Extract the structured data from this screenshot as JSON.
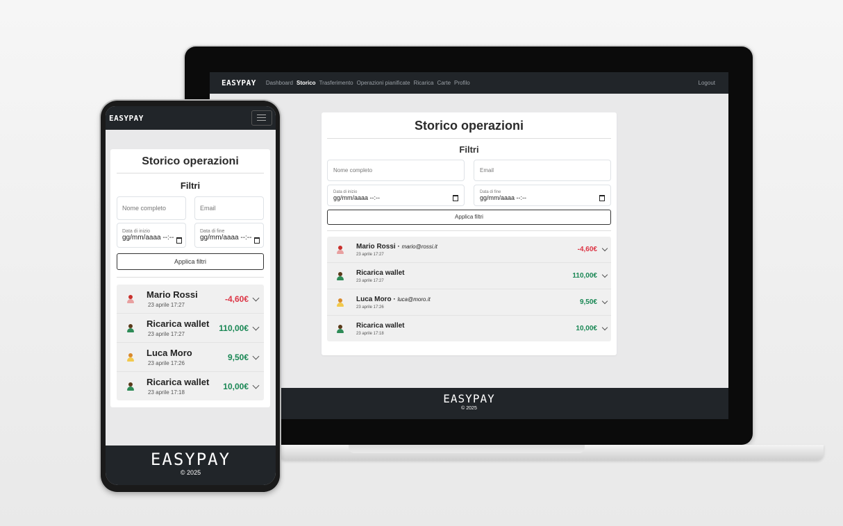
{
  "brand": "EASYPAY",
  "laptop": {
    "nav": {
      "items": [
        "Dashboard",
        "Storico",
        "Trasferimento",
        "Operazioni pianificate",
        "Ricarica",
        "Carte",
        "Profilo"
      ],
      "active": "Storico",
      "logout": "Logout"
    }
  },
  "page": {
    "title": "Storico operazioni",
    "filters_title": "Filtri",
    "name_placeholder": "Nome completo",
    "email_placeholder": "Email",
    "start_label": "Data di inizio",
    "end_label": "Data di fine",
    "laptop_date_value": "gg/mm/aaaa --:--",
    "phone_date_value": "gg/mm/aaaa --:--",
    "apply_button": "Applica filtri"
  },
  "transactions": [
    {
      "name": "Mario Rossi",
      "email": "mario@rossi.it",
      "date": "23 aprile 17:27",
      "amount": "-4,60€",
      "negative": true,
      "avatar": "red-person"
    },
    {
      "name": "Ricarica wallet",
      "email": "",
      "date": "23 aprile 17:27",
      "amount": "110,00€",
      "negative": false,
      "avatar": "green-person"
    },
    {
      "name": "Luca Moro",
      "email": "luca@moro.it",
      "date": "23 aprile 17:26",
      "amount": "9,50€",
      "negative": false,
      "avatar": "yellow-person"
    },
    {
      "name": "Ricarica wallet",
      "email": "",
      "date": "23 aprile 17:18",
      "amount": "10,00€",
      "negative": false,
      "avatar": "green-person"
    }
  ],
  "footer": {
    "brand": "EASYPAY",
    "copyright": "© 2025"
  },
  "colors": {
    "navbar": "#212529",
    "negative": "#dc3545",
    "positive": "#198754"
  }
}
